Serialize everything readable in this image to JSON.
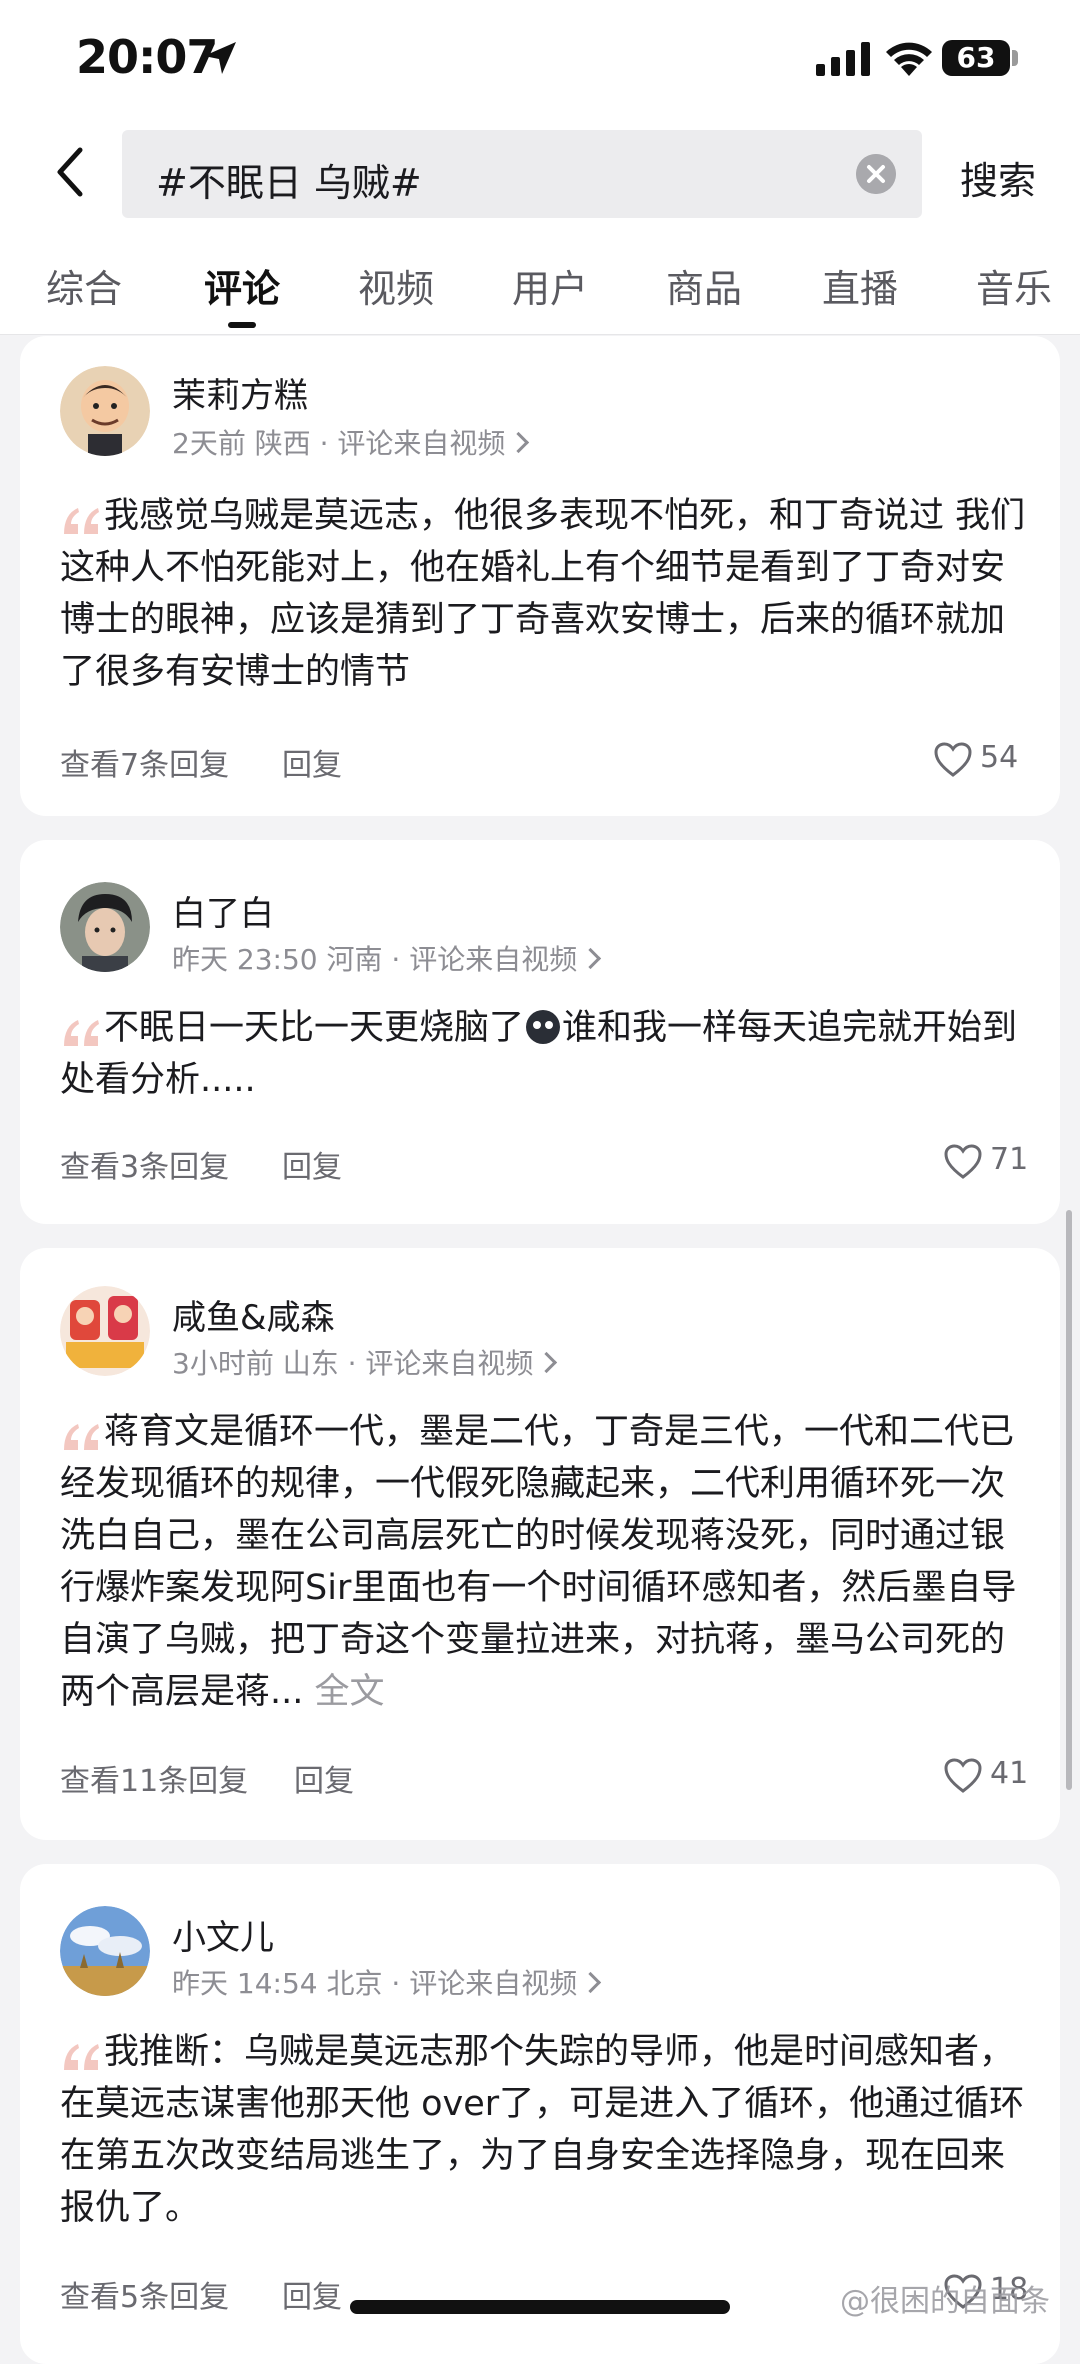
{
  "status": {
    "time": "20:07",
    "battery": "63"
  },
  "search": {
    "query": "#不眠日 乌贼#",
    "submit_label": "搜索"
  },
  "tabs": [
    {
      "label": "综合"
    },
    {
      "label": "评论"
    },
    {
      "label": "视频"
    },
    {
      "label": "用户"
    },
    {
      "label": "商品"
    },
    {
      "label": "直播"
    },
    {
      "label": "音乐"
    }
  ],
  "comments": [
    {
      "user": "茉莉方糕",
      "meta": "2天前 陕西 · 评论来自视频",
      "text": "我感觉乌贼是莫远志，他很多表现不怕死，和丁奇说过 我们这种人不怕死能对上，他在婚礼上有个细节是看到了丁奇对安博士的眼神，应该是猜到了丁奇喜欢安博士，后来的循环就加了很多有安博士的情节",
      "view_replies": "查看7条回复",
      "reply": "回复",
      "likes": "54"
    },
    {
      "user": "白了白",
      "meta": "昨天 23:50 河南 · 评论来自视频",
      "text_before": "不眠日一天比一天更烧脑了",
      "text_after": "谁和我一样每天追完就开始到处看分析.....",
      "view_replies": "查看3条回复",
      "reply": "回复",
      "likes": "71"
    },
    {
      "user": "咸鱼&咸森",
      "meta": "3小时前 山东 · 评论来自视频",
      "text": "蒋育文是循环一代，墨是二代，丁奇是三代，一代和二代已经发现循环的规律，一代假死隐藏起来，二代利用循环死一次洗白自己，墨在公司高层死亡的时候发现蒋没死，同时通过银行爆炸案发现阿Sir里面也有一个时间循环感知者，然后墨自导自演了乌贼，把丁奇这个变量拉进来，对抗蒋，墨马公司死的两个高层是蒋...",
      "more": "全文",
      "view_replies": "查看11条回复",
      "reply": "回复",
      "likes": "41"
    },
    {
      "user": "小文儿",
      "meta": "昨天 14:54 北京 · 评论来自视频",
      "text": "我推断：乌贼是莫远志那个失踪的导师，他是时间感知者，在莫远志谋害他那天他 over了，可是进入了循环，他通过循环在第五次改变结局逃生了，为了自身安全选择隐身，现在回来报仇了。",
      "view_replies": "查看5条回复",
      "reply": "回复",
      "likes": "18"
    }
  ],
  "watermark": "@很困的自面条",
  "colors": {
    "quote": "#f3c7c0",
    "card": "#ffffff",
    "background": "#f3f3f5"
  }
}
